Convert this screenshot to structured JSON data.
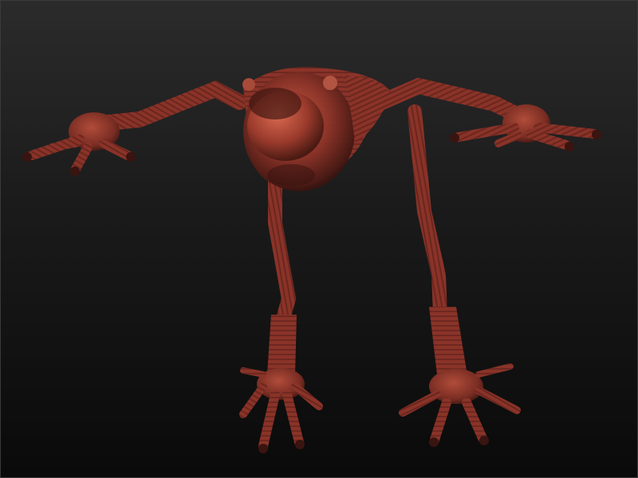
{
  "viewport": {
    "background_top": "#2b2b2b",
    "background_bottom": "#0a0a0a"
  },
  "model": {
    "subject": "creature-figure",
    "material_color": "#8a3328",
    "material_highlight": "#c85a44",
    "material_shadow": "#3a1410"
  }
}
